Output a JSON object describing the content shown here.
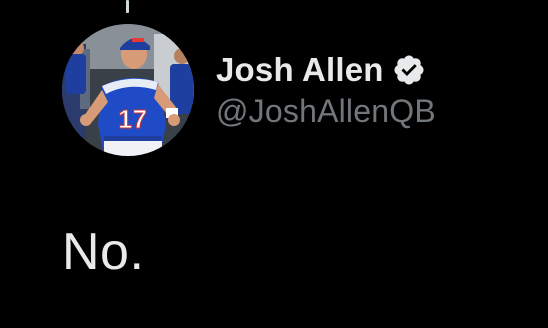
{
  "tweet": {
    "author": {
      "display_name": "Josh Allen",
      "handle": "@JoshAllenQB",
      "verified": true,
      "verified_icon": "verified-badge-icon",
      "avatar_description": "avatar-photo"
    },
    "text": "No."
  },
  "colors": {
    "background": "#000000",
    "primary_text": "#e7e9ea",
    "secondary_text": "#71767b",
    "thread_line": "#cfd9de",
    "badge": "#e7e9ea"
  }
}
